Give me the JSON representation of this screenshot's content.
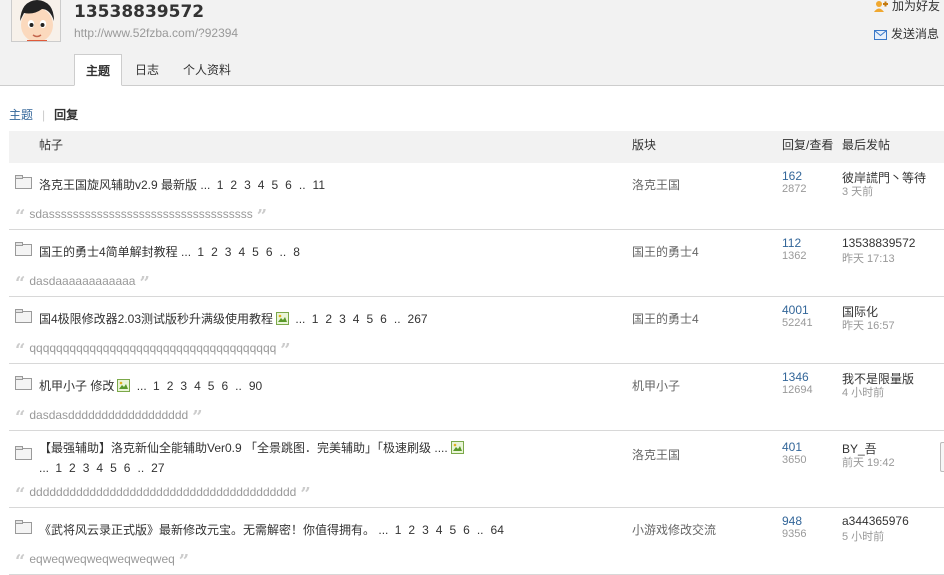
{
  "profile": {
    "username": "13538839572",
    "url": "http://www.52fzba.com/?92394",
    "actions": {
      "add_friend": "加为好友",
      "send_message": "发送消息"
    }
  },
  "tabs": [
    "主题",
    "日志",
    "个人资料"
  ],
  "subnav": {
    "topics": "主题",
    "separator": "|",
    "replies": "回复"
  },
  "table": {
    "headers": {
      "post": "帖子",
      "forum": "版块",
      "reply_view": "回复/查看",
      "last_post": "最后发帖"
    },
    "rows": [
      {
        "title": "洛克王国旋风辅助v2.9 最新版",
        "ellipsis": "...",
        "pages": [
          "1",
          "2",
          "3",
          "4",
          "5",
          "6",
          "..",
          "11"
        ],
        "forum": "洛克王国",
        "replies": "162",
        "views": "2872",
        "last_user": "彼岸謊門丶等待",
        "last_time": "3 天前",
        "quote": "sdassssssssssssssssssssssssssssssssss"
      },
      {
        "title": "国王的勇士4简单解封教程",
        "ellipsis": "...",
        "pages": [
          "1",
          "2",
          "3",
          "4",
          "5",
          "6",
          "..",
          "8"
        ],
        "forum": "国王的勇士4",
        "replies": "112",
        "views": "1362",
        "last_user": "13538839572",
        "last_time": "昨天 17:13",
        "quote": "dasdaaaaaaaaaaaa"
      },
      {
        "title": "国4极限修改器2.03测试版秒升满级使用教程",
        "ellipsis": "...",
        "pages": [
          "1",
          "2",
          "3",
          "4",
          "5",
          "6",
          "..",
          "267"
        ],
        "forum": "国王的勇士4",
        "replies": "4001",
        "views": "52241",
        "last_user": "国际化",
        "last_time": "昨天 16:57",
        "quote": "qqqqqqqqqqqqqqqqqqqqqqqqqqqqqqqqqqqqq",
        "has_image": true
      },
      {
        "title": "机甲小子 修改",
        "ellipsis": "...",
        "pages": [
          "1",
          "2",
          "3",
          "4",
          "5",
          "6",
          "..",
          "90"
        ],
        "forum": "机甲小子",
        "replies": "1346",
        "views": "12694",
        "last_user": "我不是限量版",
        "last_time": "4 小时前",
        "quote": "dasdasdddddddddddddddddd",
        "has_image": true
      },
      {
        "title": "【最强辅助】洛克新仙全能辅助Ver0.9 「全景跳图．完美辅助」「极速刷级 ....",
        "ellipsis": "...",
        "pages": [
          "1",
          "2",
          "3",
          "4",
          "5",
          "6",
          "..",
          "27"
        ],
        "forum": "洛克王国",
        "replies": "401",
        "views": "3650",
        "last_user": "BY_吾",
        "last_time": "前天 19:42",
        "quote": "dddddddddddddddddddddddddddddddddddddddd",
        "has_image": true
      },
      {
        "title": "《武将风云录正式版》最新修改元宝。无需解密！你值得拥有。",
        "ellipsis": "...",
        "pages": [
          "1",
          "2",
          "3",
          "4",
          "5",
          "6",
          "..",
          "64"
        ],
        "forum": "小游戏修改交流",
        "replies": "948",
        "views": "9356",
        "last_user": "a344365976",
        "last_time": "5 小时前",
        "quote": "eqweqweqweqweqweqweq"
      }
    ]
  },
  "colors": {
    "link": "#336699",
    "header_bg": "#f2f2f2",
    "muted": "#999999"
  }
}
